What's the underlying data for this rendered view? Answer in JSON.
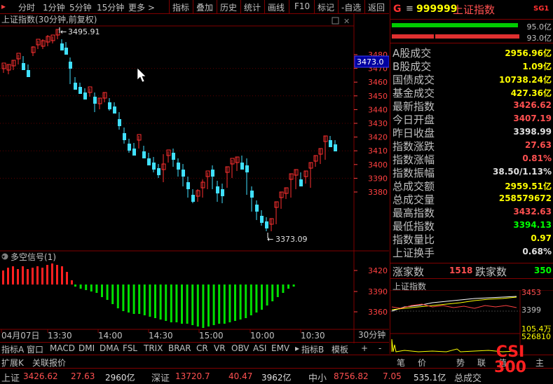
{
  "toolbar": {
    "items": [
      "分时",
      "1分钟",
      "5分钟",
      "15分钟",
      "更多 >",
      "指标",
      "叠加",
      "历史",
      "统计",
      "画线",
      "F10",
      "标记",
      "-自选",
      "返回"
    ]
  },
  "chart": {
    "title": "上证指数(30分钟,前复权)",
    "high_label": "3495.91",
    "low_label": "3373.09",
    "price_box": "3473.0",
    "y_ticks": [
      "3480",
      "3470",
      "3460",
      "3450",
      "3440",
      "3430",
      "3420",
      "3410",
      "3400",
      "3390",
      "3380"
    ],
    "indicator_title": "多空信号(1)",
    "indicator_ticks": [
      "3420",
      "3390",
      "3360"
    ],
    "x_labels": [
      "04月07日",
      "13:30",
      "14:00",
      "14:30",
      "15:00",
      "10:00",
      "10:30"
    ],
    "period_box": "30分钟"
  },
  "tabs": [
    "指标A",
    "窗口",
    "MACD",
    "DMI",
    "DMA",
    "FSL",
    "TRIX",
    "BRAR",
    "CR",
    "VR",
    "OBV",
    "ASI",
    "EMV",
    "指标B",
    "模板",
    "+",
    "-"
  ],
  "panel": {
    "header_letter": "G",
    "header_menu": "≡",
    "code": "999999",
    "name": "上证指数",
    "tag": "SG1",
    "bar1_pct": "95.0亿",
    "bar2_pct": "93.0亿",
    "rows": [
      {
        "label": "A股成交",
        "value": "2956.96亿",
        "color": "yel"
      },
      {
        "label": "B股成交",
        "value": "1.09亿",
        "color": "yel"
      },
      {
        "label": "国债成交",
        "value": "10738.24亿",
        "color": "yel"
      },
      {
        "label": "基金成交",
        "value": "427.36亿",
        "color": "yel"
      },
      {
        "label": "最新指数",
        "value": "3426.62",
        "color": "red"
      },
      {
        "label": "今日开盘",
        "value": "3407.19",
        "color": "red"
      },
      {
        "label": "昨日收盘",
        "value": "3398.99",
        "color": "wht"
      },
      {
        "label": "指数涨跌",
        "value": "27.63",
        "color": "red"
      },
      {
        "label": "指数涨幅",
        "value": "0.81%",
        "color": "red"
      },
      {
        "label": "指数振幅",
        "value": "38.50/1.13%",
        "color": "wht"
      },
      {
        "label": "总成交额",
        "value": "2959.51亿",
        "color": "yel"
      },
      {
        "label": "总成交量",
        "value": "258579672",
        "color": "yel"
      },
      {
        "label": "最高指数",
        "value": "3432.63",
        "color": "red"
      },
      {
        "label": "最低指数",
        "value": "3394.13",
        "color": "grn"
      },
      {
        "label": "指数量比",
        "value": "0.97",
        "color": "yel"
      },
      {
        "label": "上证换手",
        "value": "0.68%",
        "color": "wht"
      }
    ],
    "up_label": "涨家数",
    "up_value": "1518",
    "down_label": "跌家数",
    "down_value": "350",
    "mini_title": "上证指数",
    "mini_high": "3453",
    "mini_mid": "3399",
    "mini_vol": "105.4万",
    "mini_vol2": "526810",
    "bottom_tabs": [
      "笔",
      "价",
      "势",
      "联",
      "值",
      "主"
    ]
  },
  "footer": {
    "tabs": [
      "扩展K",
      "关联报价"
    ],
    "quotes": [
      {
        "name": "上证",
        "price": "3426.62",
        "chg": "27.63",
        "amt": "2960亿"
      },
      {
        "name": "深证",
        "price": "13720.7",
        "chg": "40.47",
        "amt": "3962亿"
      },
      {
        "name": "中小",
        "price": "8756.82",
        "chg": "7.05",
        "amt": "535.1亿"
      }
    ],
    "tail": "总成交",
    "logo": "CSI 300"
  }
}
